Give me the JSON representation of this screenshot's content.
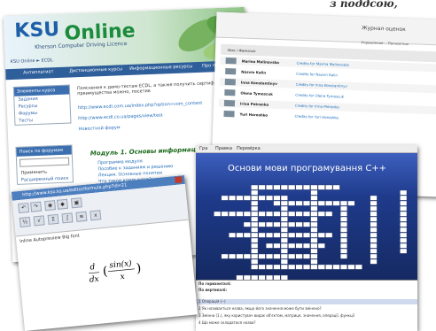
{
  "caption": "з поддсою,",
  "ksu_site": {
    "logo_ksu": "KSU",
    "logo_online": "Online",
    "subtitle": "Kherson Computer Driving Licence",
    "breadcrumb": "KSU Online ► ECDL",
    "nav": [
      "Антиплагиат",
      "Дистанционные курсы",
      "Информационные ресурсы",
      "Про проект"
    ],
    "side_header": "Элементы курса",
    "side_items": [
      "Задания",
      "Ресурсы",
      "Форумы",
      "Тесты"
    ],
    "side_header2": "Поиск по форумам",
    "side_btn": "Применить",
    "side_extra": "Расширенный поиск",
    "intro_text": "Пояснения к демо-тестам ECDL, а также получить сертификацию и ее преимущества можно, посетив",
    "links": [
      "http://www.ecdl.com.ua/index.php?option=com_content",
      "http://www.ecdl.co.ua/pages/view/test"
    ],
    "news_forum": "Новостной форум",
    "module_title": "Модуль 1. Основы информационных",
    "module_items": [
      "Программа модуля",
      "Пособие к заданиям и решению",
      "Лекция. Основные понятия",
      "Что такое компьютер?"
    ]
  },
  "journal": {
    "title": "Журнал оценок",
    "col_header": "Управление ...Полностью",
    "col_name": "Имя / Фамилия",
    "rows": [
      {
        "name": "Marina Malinovsko",
        "grade": "Credits for Marina Malinovsko"
      },
      {
        "name": "Nazvin Kalin",
        "grade": "Credits for Nazvin Kalin"
      },
      {
        "name": "Inna Konstantinyv",
        "grade": "Credits for Inna Konstantinyv"
      },
      {
        "name": "Olena Tymoscuk",
        "grade": "Credits for Olena Tymoscuk"
      },
      {
        "name": "Irina Petrenko",
        "grade": "Credits for Irina Petrenko"
      },
      {
        "name": "Yuri Horoshko",
        "grade": "Credits for Yuri Horoshko"
      }
    ]
  },
  "crossword": {
    "menu": [
      "Гра",
      "Правка",
      "Перевірка"
    ],
    "title": "Основи мови програмування C++",
    "clues_header1": "По горизонталі:",
    "clues_header2": "По вертикалі:",
    "clues": [
      "1 Операція (--)",
      "2 Як називається назва, якщо його значення може бути змінено?",
      "3 Змінна (1.), яку користувач видає об'єктом, матриця, значення, операції, функції",
      "4 Що може складатися назва?"
    ]
  },
  "formula_editor": {
    "window_title": "http://www.ksu.ks.ua/editor/formula.php?id=21",
    "options_text": "Inline   Autopreview   Big font",
    "formula_numerator": "sin(x)",
    "formula_denominator": "x",
    "formula_prefix": "d",
    "formula_prefix_den": "dx"
  },
  "colors": {
    "ksu_blue": "#1e5fa8",
    "ksu_green": "#1b8b3c",
    "crossword_bg": "#1e3a8a"
  }
}
